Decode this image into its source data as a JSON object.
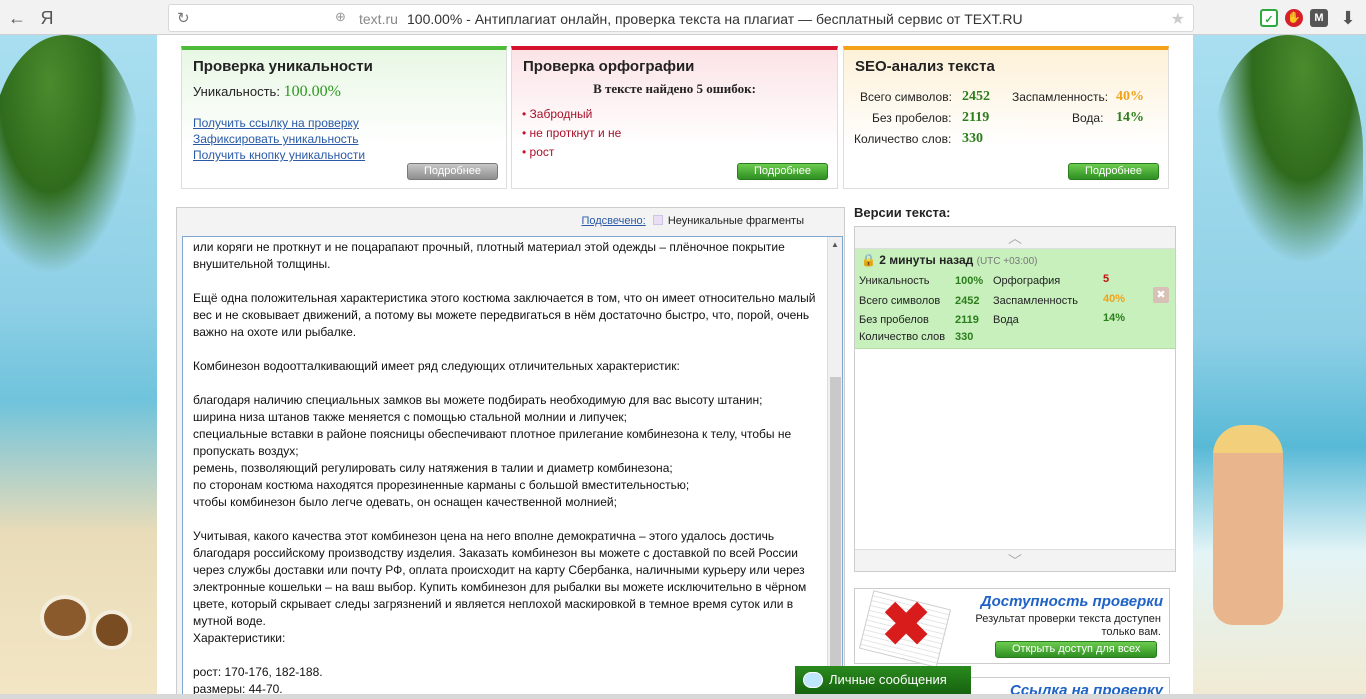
{
  "browser": {
    "back": "←",
    "yandex": "Я",
    "reload": "↻",
    "host": "text.ru",
    "title": "100.00% - Антиплагиат онлайн, проверка текста на плагиат — бесплатный сервис от TEXT.RU",
    "star": "★",
    "download": "⬇"
  },
  "uniqueness": {
    "title": "Проверка уникальности",
    "label": "Уникальность:",
    "value": "100.00%",
    "links": [
      "Получить ссылку на проверку",
      "Зафиксировать уникальность",
      "Получить кнопку уникальности"
    ],
    "button": "Подробнее"
  },
  "spelling": {
    "title": "Проверка орфографии",
    "summary": "В тексте найдено 5 ошибок:",
    "errors": [
      "Забродный",
      "не проткнут и не",
      "рост"
    ],
    "button": "Подробнее"
  },
  "seo": {
    "title": "SEO-анализ текста",
    "total_label": "Всего символов:",
    "total": "2452",
    "spam_label": "Заспамленность:",
    "spam": "40%",
    "nospace_label": "Без пробелов:",
    "nospace": "2119",
    "water_label": "Вода:",
    "water": "14%",
    "words_label": "Количество слов:",
    "words": "330",
    "button": "Подробнее"
  },
  "highlight": {
    "link": "Подсвечено:",
    "legend": "Неуникальные фрагменты"
  },
  "text": [
    "или коряги не проткнут и не поцарапают прочный, плотный материал этой одежды – плёночное покрытие внушительной толщины.",
    "",
    "Ещё одна положительная характеристика этого костюма заключается в том, что он имеет относительно малый вес и не сковывает движений, а потому вы можете передвигаться в нём достаточно быстро, что, порой, очень важно на охоте или рыбалке.",
    "",
    "Комбинезон водоотталкивающий имеет ряд следующих отличительных характеристик:",
    "",
    "благодаря наличию специальных замков вы можете подбирать необходимую для вас высоту штанин;",
    "ширина низа штанов также меняется с помощью стальной молнии и липучек;",
    "специальные вставки в районе поясницы обеспечивают плотное прилегание комбинезона к телу, чтобы не пропускать воздух;",
    "ремень, позволяющий регулировать силу натяжения в талии и диаметр комбинезона;",
    "по сторонам костюма находятся прорезиненные карманы с большой вместительностью;",
    "чтобы комбинезон было легче одевать, он оснащен качественной молнией;",
    "",
    "Учитывая, какого качества этот комбинезон цена на него вполне демократична – этого удалось достичь благодаря российскому производству изделия. Заказать комбинезон вы можете с доставкой по всей России через службы доставки или почту РФ, оплата происходит на карту Сбербанка, наличными курьеру или через электронные кошельки – на ваш выбор. Купить комбинезон для рыбалки вы можете исключительно в чёрном цвете, который скрывает следы загрязнений и является неплохой маскировкой в темное время суток или в мутной воде.",
    "Характеристики:",
    "",
    "рост: 170-176, 182-188.",
    "размеры: 44-70."
  ],
  "versions": {
    "title": "Версии текста:",
    "up": "︿",
    "down": "﹀",
    "item": {
      "time": "2 минуты назад",
      "tz": "(UTC +03:00)",
      "uniq_label": "Уникальность",
      "uniq": "100%",
      "spell_label": "Орфография",
      "spell": "5",
      "total_label": "Всего символов",
      "total": "2452",
      "spam_label": "Заспамленность",
      "spam": "40%",
      "nospace_label": "Без пробелов",
      "nospace": "2119",
      "water_label": "Вода",
      "water": "14%",
      "words_label": "Количество слов",
      "words": "330",
      "close": "✖"
    }
  },
  "promo": {
    "title": "Доступность проверки",
    "text": "Результат проверки текста доступен только вам.",
    "button": "Открыть доступ для всех",
    "title2": "Ссылка на проверку"
  },
  "messages": {
    "label": "Личные сообщения"
  },
  "colors": {
    "green": "#4dbb3a",
    "red": "#d6122f",
    "orange": "#f5a21a",
    "link": "#2a5aa7"
  }
}
